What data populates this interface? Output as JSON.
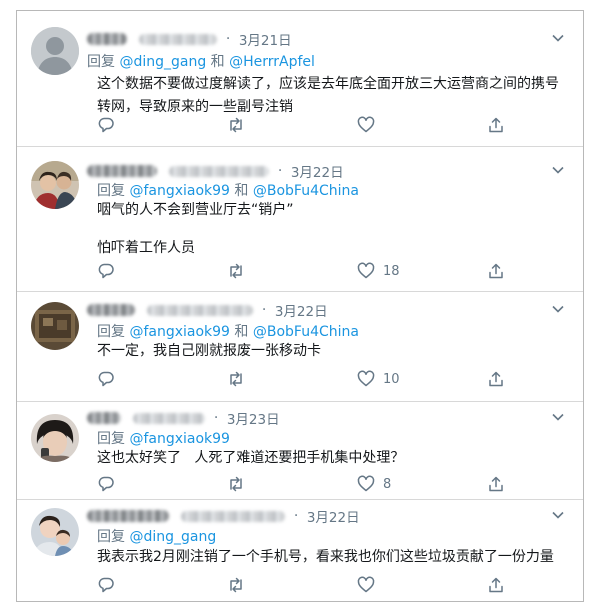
{
  "tweets": [
    {
      "date": "3月21日",
      "reply_prefix": "回复",
      "mentions": [
        "@ding_gang",
        "@HerrrApfel"
      ],
      "conj": "和",
      "lines": [
        "这个数据不要做过度解读了，应该是去年底全面开放三大运营商之间的携号",
        "转网，导致原来的一些副号注销"
      ],
      "likes": ""
    },
    {
      "date": "3月22日",
      "reply_prefix": "回复",
      "mentions": [
        "@fangxiaok99",
        "@BobFu4China"
      ],
      "conj": "和",
      "lines": [
        "咽气的人不会到营业厅去“销户”",
        "",
        "怕吓着工作人员"
      ],
      "likes": "18"
    },
    {
      "date": "3月22日",
      "reply_prefix": "回复",
      "mentions": [
        "@fangxiaok99",
        "@BobFu4China"
      ],
      "conj": "和",
      "lines": [
        "不一定，我自己刚就报废一张移动卡"
      ],
      "likes": "10"
    },
    {
      "date": "3月23日",
      "reply_prefix": "回复",
      "mentions": [
        "@fangxiaok99"
      ],
      "conj": "",
      "lines": [
        "这也太好笑了   人死了难道还要把手机集中处理？"
      ],
      "likes": "8"
    },
    {
      "date": "3月22日",
      "reply_prefix": "回复",
      "mentions": [
        "@ding_gang"
      ],
      "conj": "",
      "lines": [
        "我表示我2月刚注销了一个手机号，看来我也你们这些垃圾贡献了一份力量"
      ],
      "likes": ""
    }
  ],
  "icons": {
    "reply": "reply-icon",
    "retweet": "retweet-icon",
    "like": "heart-icon",
    "share": "share-icon",
    "more": "chevron-down-icon"
  },
  "colors": {
    "mention": "#1b95e0",
    "meta": "#657786",
    "text": "#14171a"
  }
}
